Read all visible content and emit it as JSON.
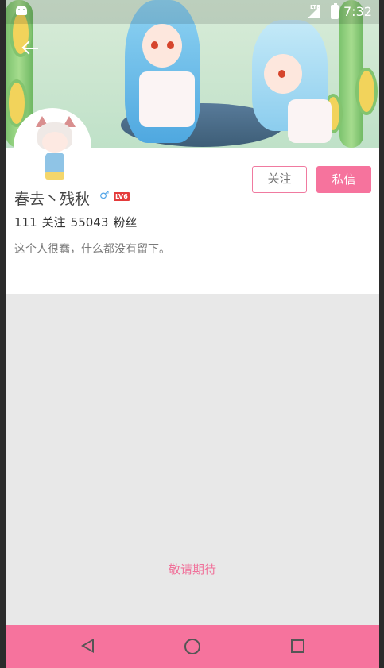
{
  "status_bar": {
    "time": "7:32",
    "network": "LTE",
    "icons": [
      "android-icon",
      "signal-icon",
      "battery-icon"
    ]
  },
  "header": {
    "back_icon": "arrow-left-icon"
  },
  "profile": {
    "username": "春去丶残秋",
    "gender_icon": "♂",
    "level_badge": "LV6",
    "following_count": "111",
    "following_label": "关注",
    "followers_count": "55043",
    "followers_label": "粉丝",
    "bio": "这个人很蠢，什么都没有留下。"
  },
  "actions": {
    "follow_label": "关注",
    "message_label": "私信"
  },
  "content": {
    "placeholder_text": "敬请期待"
  },
  "nav_bar": {
    "icons": [
      "back-triangle-icon",
      "home-circle-icon",
      "recent-square-icon"
    ]
  },
  "colors": {
    "accent": "#f6739d",
    "follow_border": "#f07aa0",
    "background": "#e8e8e8",
    "level_badge": "#e43b3b",
    "gender": "#56a7e8"
  }
}
